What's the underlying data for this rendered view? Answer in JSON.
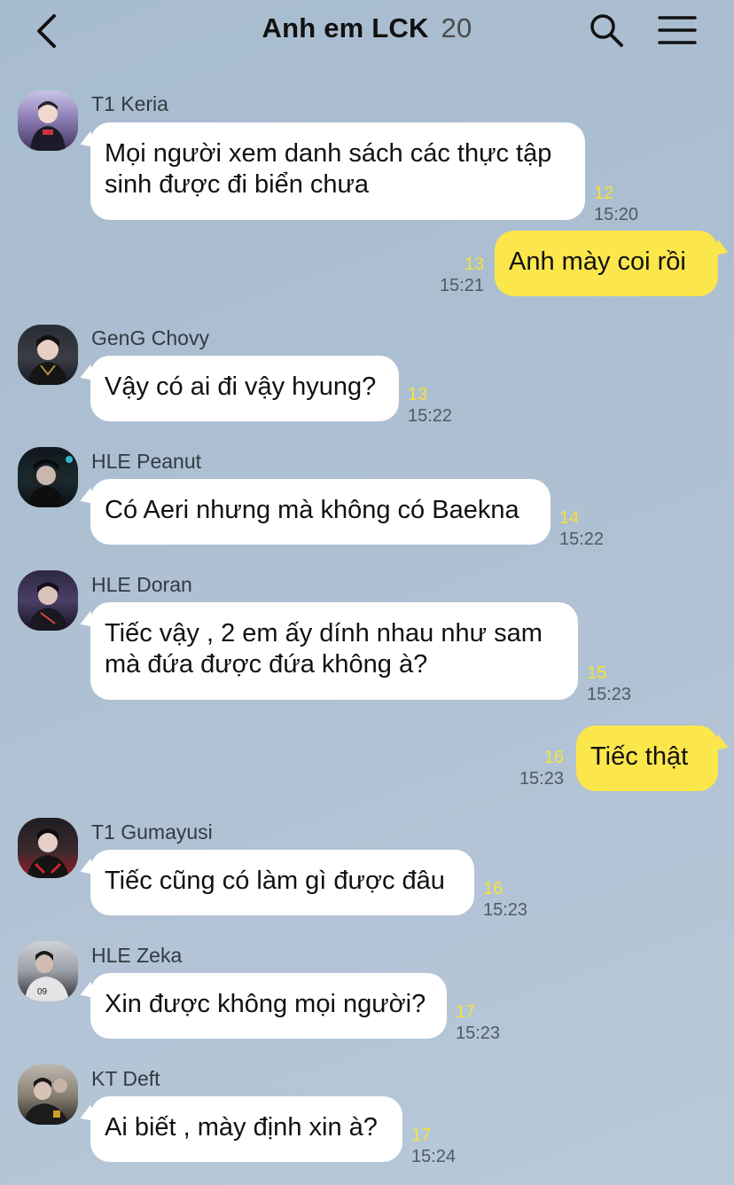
{
  "header": {
    "title": "Anh em LCK",
    "member_count": "20",
    "back_icon": "chevron-left-icon",
    "search_icon": "search-icon",
    "menu_icon": "hamburger-menu-icon"
  },
  "colors": {
    "background": "#aebfd1",
    "incoming_bubble": "#ffffff",
    "outgoing_bubble": "#fbe64c",
    "unread_count": "#f5e23a"
  },
  "messages": [
    {
      "sender": "T1 Keria",
      "lines": [
        "Mọi người xem danh sách các thực tập",
        "sinh được đi biển chưa"
      ],
      "unread": "12",
      "time": "15:20",
      "outgoing": false
    },
    {
      "sender": "",
      "lines": [
        "Anh mày coi rồi"
      ],
      "unread": "13",
      "time": "15:21",
      "outgoing": true
    },
    {
      "sender": "GenG Chovy",
      "lines": [
        "Vậy có ai đi vậy hyung?"
      ],
      "unread": "13",
      "time": "15:22",
      "outgoing": false
    },
    {
      "sender": "HLE Peanut",
      "lines": [
        "Có Aeri nhưng mà không có Baekna"
      ],
      "unread": "14",
      "time": "15:22",
      "outgoing": false
    },
    {
      "sender": "HLE Doran",
      "lines": [
        "Tiếc vậy , 2 em ấy dính nhau như sam",
        "mà đứa được đứa không à?"
      ],
      "unread": "15",
      "time": "15:23",
      "outgoing": false
    },
    {
      "sender": "",
      "lines": [
        "Tiếc thật"
      ],
      "unread": "16",
      "time": "15:23",
      "outgoing": true
    },
    {
      "sender": "T1 Gumayusi",
      "lines": [
        "Tiếc cũng có làm gì được đâu"
      ],
      "unread": "16",
      "time": "15:23",
      "outgoing": false
    },
    {
      "sender": "HLE Zeka",
      "lines": [
        "Xin được không mọi người?"
      ],
      "unread": "17",
      "time": "15:23",
      "outgoing": false
    },
    {
      "sender": "KT Deft",
      "lines": [
        "Ai biết , mày định xin à?"
      ],
      "unread": "17",
      "time": "15:24",
      "outgoing": false
    }
  ]
}
